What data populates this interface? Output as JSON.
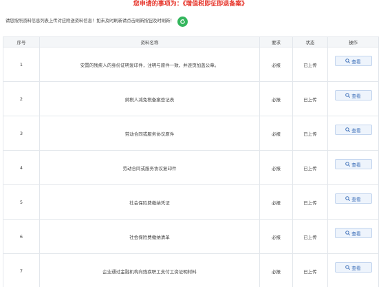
{
  "header": {
    "title_prefix": "您申请的事项为：",
    "title_item": "《增值税即征即退备案》"
  },
  "instruction": {
    "text": "请您按照资料信息列表上传对应附送资料信息！如未及时刷新请点击刷新按钮及时刷新！",
    "refresh_icon": "refresh-icon",
    "refresh_color": "#34b65d"
  },
  "table": {
    "columns": {
      "index": "序号",
      "name": "资料名称",
      "requirement": "要求",
      "status": "状态",
      "action": "操作"
    },
    "rows": [
      {
        "index": "1",
        "name": "安置的残疾人的身份证明复印件，注明与原件一致，并逐页加盖公章。",
        "requirement": "必报",
        "status": "已上传",
        "action": "查看"
      },
      {
        "index": "2",
        "name": "纳税人减免税备案登记表",
        "requirement": "必报",
        "status": "已上传",
        "action": "查看"
      },
      {
        "index": "3",
        "name": "劳动合同或服务协议原件",
        "requirement": "必报",
        "status": "已上传",
        "action": "查看"
      },
      {
        "index": "4",
        "name": "劳动合同或服务协议复印件",
        "requirement": "必报",
        "status": "已上传",
        "action": "查看"
      },
      {
        "index": "5",
        "name": "社会保险费缴纳凭证",
        "requirement": "必报",
        "status": "已上传",
        "action": "查看"
      },
      {
        "index": "6",
        "name": "社会保险费缴纳清单",
        "requirement": "必报",
        "status": "已上传",
        "action": "查看"
      },
      {
        "index": "7",
        "name": "企业通过金融机构向残疾职工支付工资证明材料",
        "requirement": "必报",
        "status": "已上传",
        "action": "查看"
      }
    ]
  },
  "colors": {
    "title": "#e6352b",
    "button_text": "#3a6db7",
    "button_bg": "#eef4fc",
    "header_bg": "#f4f6f8"
  }
}
